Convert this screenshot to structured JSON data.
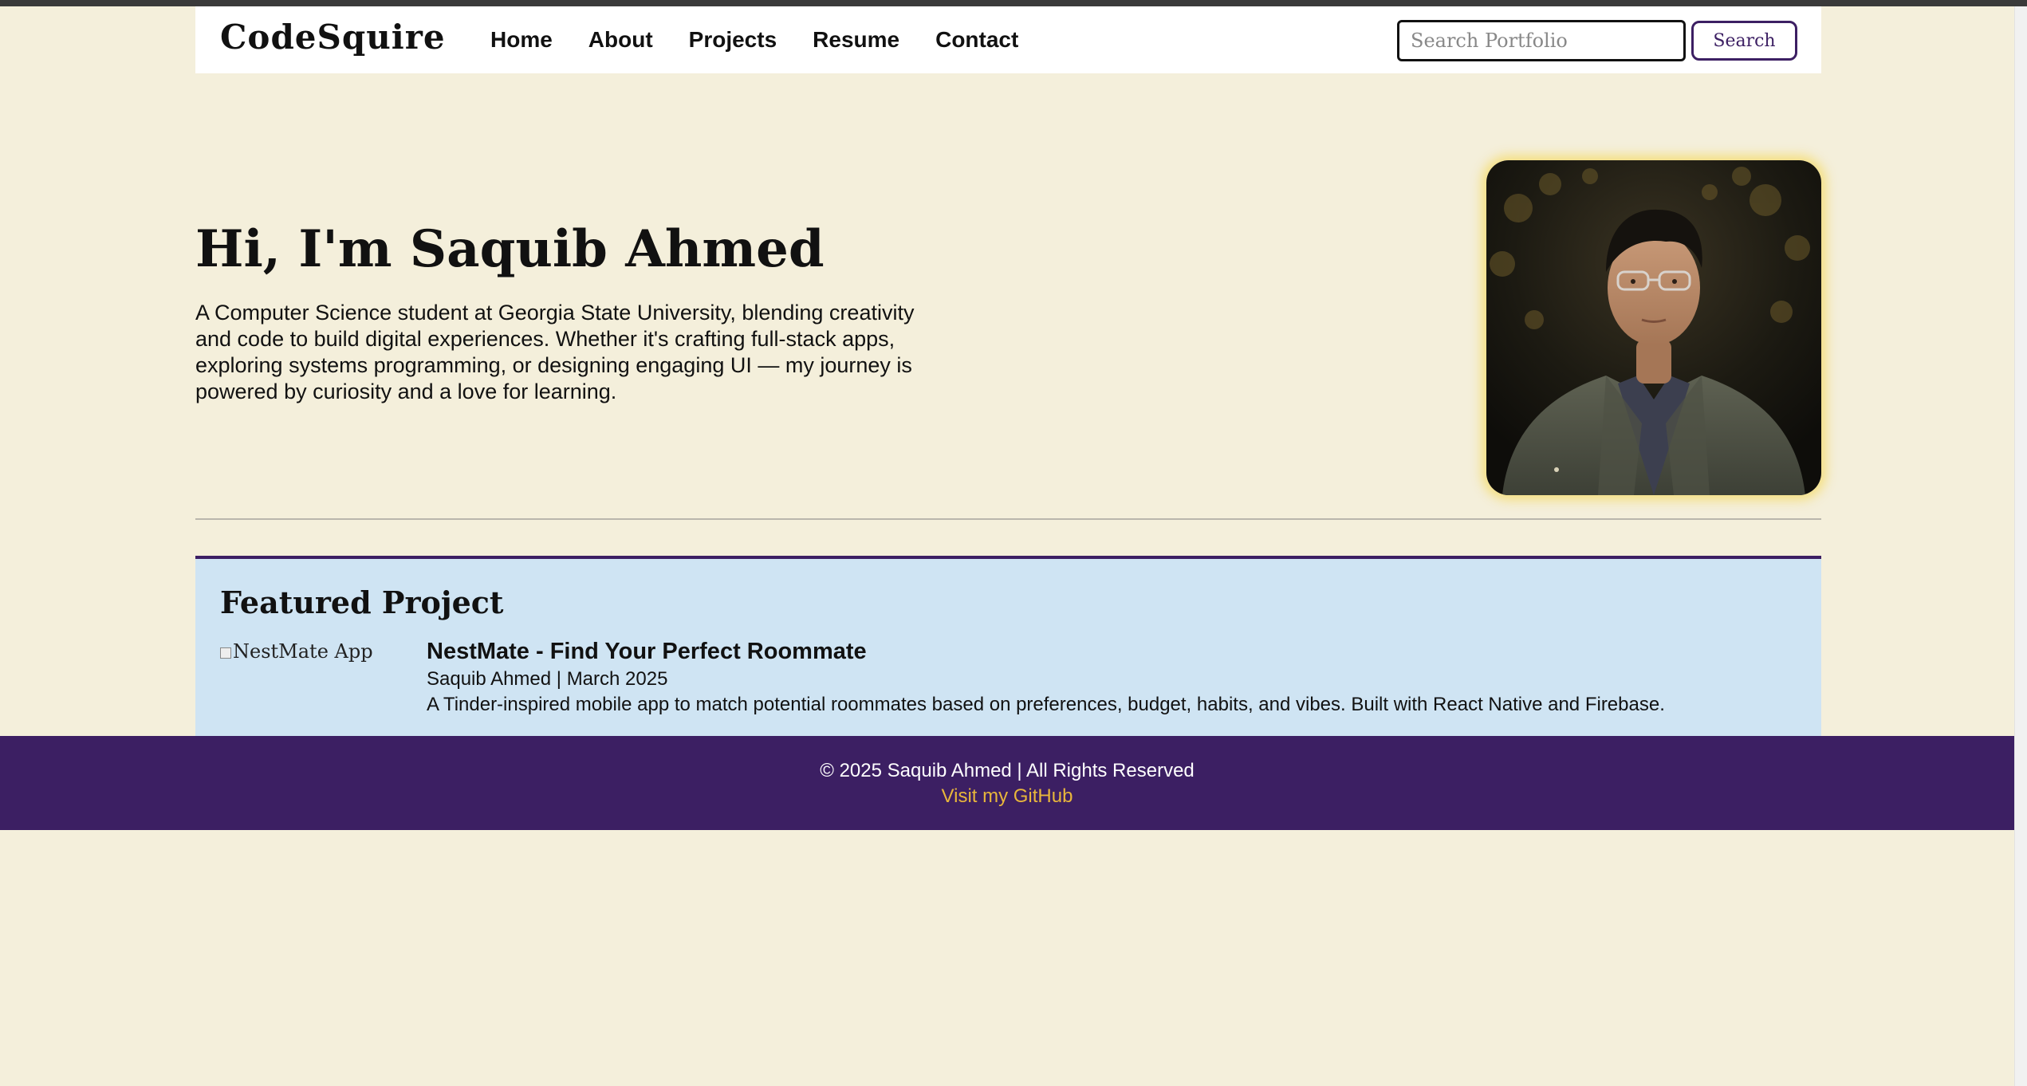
{
  "navbar": {
    "brand": "CodeSquire",
    "links": [
      "Home",
      "About",
      "Projects",
      "Resume",
      "Contact"
    ],
    "search": {
      "placeholder": "Search Portfolio",
      "value": ""
    },
    "search_button": "Search"
  },
  "hero": {
    "title": "Hi, I'm Saquib Ahmed",
    "description": "A Computer Science student at Georgia State University, blending creativity and code to build digital experiences. Whether it's crafting full-stack apps, exploring systems programming, or designing engaging UI — my journey is powered by curiosity and a love for learning."
  },
  "featured": {
    "heading": "Featured Project",
    "image_alt": "NestMate App",
    "title": "NestMate - Find Your Perfect Roommate",
    "meta": "Saquib Ahmed | March 2025",
    "description": "A Tinder-inspired mobile app to match potential roommates based on preferences, budget, habits, and vibes. Built with React Native and Firebase."
  },
  "footer": {
    "copyright": "© 2025 Saquib Ahmed | All Rights Reserved",
    "github_link": "Visit my GitHub"
  },
  "colors": {
    "page_bg": "#f4efdb",
    "accent_purple": "#3c1f63",
    "featured_bg": "#cfe4f3",
    "link_gold": "#e8b63b",
    "photo_glow": "#f5dc6e"
  }
}
